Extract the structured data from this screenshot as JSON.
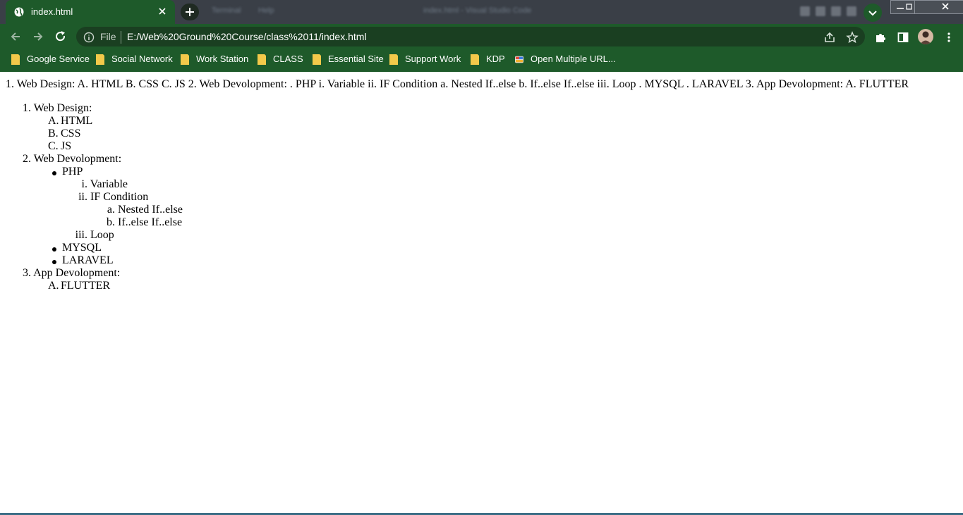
{
  "browser": {
    "tab": {
      "title": "index.html"
    },
    "blurred_title": "index.html - Visual Studio Code",
    "blurred_menu": [
      "Terminal",
      "Help"
    ],
    "address": {
      "scheme_label": "File",
      "url": "E:/Web%20Ground%20Course/class%2011/index.html"
    },
    "bookmarks": [
      {
        "label": "Google Service"
      },
      {
        "label": "Social Network"
      },
      {
        "label": "Work Station"
      },
      {
        "label": "CLASS"
      },
      {
        "label": "Essential Site"
      },
      {
        "label": "Support Work"
      },
      {
        "label": "KDP"
      },
      {
        "label": "Open Multiple URL..."
      }
    ],
    "colors": {
      "chrome_green": "#1e5a2a",
      "titlebar": "#3a3f47",
      "folder_yellow": "#f3c94a"
    }
  },
  "page": {
    "flat_text": "1. Web Design: A. HTML B. CSS C. JS 2. Web Devolopment: . PHP i. Variable ii. IF Condition a. Nested If..else b. If..else If..else iii. Loop . MYSQL . LARAVEL 3. App Devolopment: A. FLUTTER",
    "list": {
      "items": [
        {
          "marker": "1.",
          "label": "Web Design:"
        },
        {
          "marker": "A.",
          "label": "HTML"
        },
        {
          "marker": "B.",
          "label": "CSS"
        },
        {
          "marker": "C.",
          "label": "JS"
        },
        {
          "marker": "2.",
          "label": "Web Devolopment:"
        },
        {
          "marker": "",
          "label": "PHP"
        },
        {
          "marker": "i.",
          "label": "Variable"
        },
        {
          "marker": "ii.",
          "label": "IF Condition"
        },
        {
          "marker": "a.",
          "label": "Nested If..else"
        },
        {
          "marker": "b.",
          "label": "If..else If..else"
        },
        {
          "marker": "iii.",
          "label": "Loop"
        },
        {
          "marker": "",
          "label": "MYSQL"
        },
        {
          "marker": "",
          "label": "LARAVEL"
        },
        {
          "marker": "3.",
          "label": "App Devolopment:"
        },
        {
          "marker": "A.",
          "label": "FLUTTER"
        }
      ]
    }
  }
}
